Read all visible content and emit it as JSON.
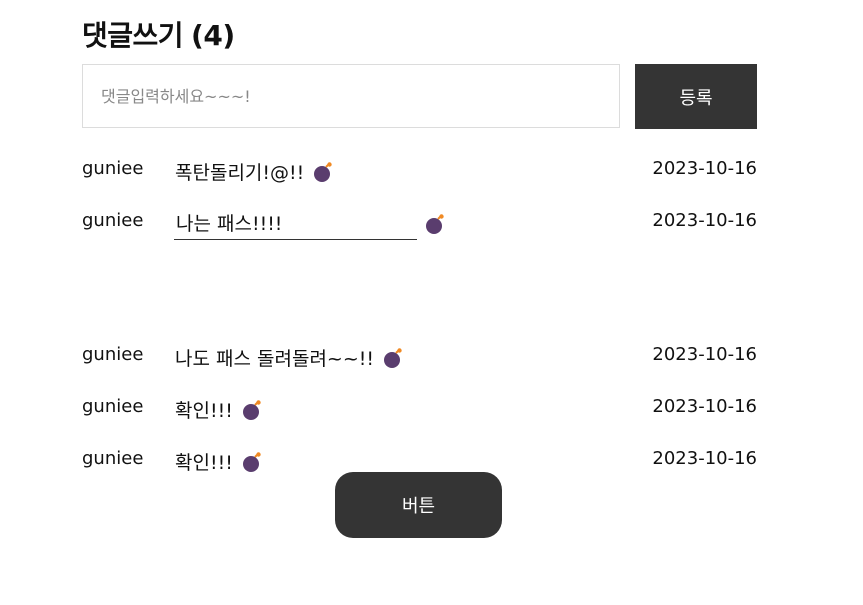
{
  "header": {
    "title": "댓글쓰기",
    "count": "(4)"
  },
  "form": {
    "placeholder": "댓글입력하세요~~~!",
    "value": "",
    "submit_label": "등록"
  },
  "comments": [
    {
      "user": "guniee",
      "text": "폭탄돌리기!@!!",
      "date": "2023-10-16"
    },
    {
      "user": "guniee",
      "edit_value": "나는 패스!!!!",
      "date": "2023-10-16"
    },
    {
      "user": "guniee",
      "text": "나도 패스 돌려돌려~~!!",
      "date": "2023-10-16"
    },
    {
      "user": "guniee",
      "text": "확인!!!",
      "date": "2023-10-16"
    },
    {
      "user": "guniee",
      "text": "확인!!!",
      "date": "2023-10-16"
    }
  ],
  "icons": {
    "delete": "bomb-icon"
  },
  "colors": {
    "button_bg": "#343434",
    "bomb_body": "#5a3d6e",
    "bomb_fuse": "#f08a24"
  },
  "bottom_button": {
    "label": "버튼"
  }
}
